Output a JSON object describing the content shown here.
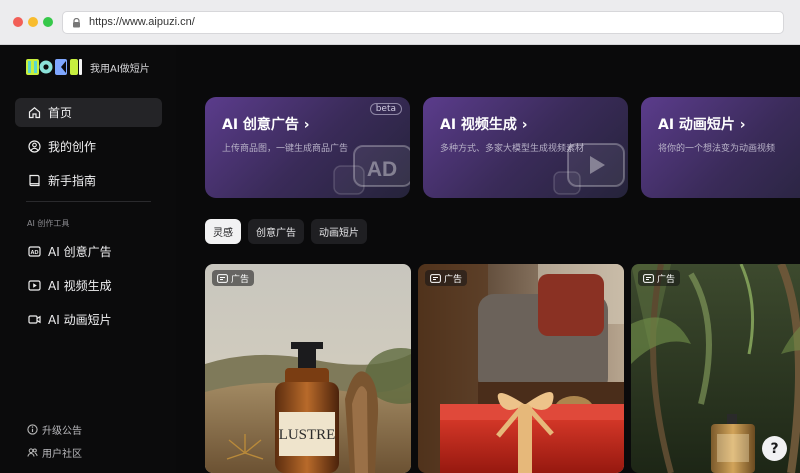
{
  "browser": {
    "url": "https://www.aipuzi.cn/"
  },
  "sidebar": {
    "logo_tagline": "我用AI做短片",
    "items": [
      {
        "label": "首页",
        "icon": "home-icon"
      },
      {
        "label": "我的创作",
        "icon": "user-circle-icon"
      },
      {
        "label": "新手指南",
        "icon": "book-icon"
      }
    ],
    "section_title": "AI 创作工具",
    "tools": [
      {
        "label": "AI 创意广告",
        "icon": "ad-icon"
      },
      {
        "label": "AI 视频生成",
        "icon": "play-icon"
      },
      {
        "label": "AI 动画短片",
        "icon": "video-camera-icon"
      }
    ],
    "bottom": [
      {
        "label": "升级公告",
        "icon": "info-icon"
      },
      {
        "label": "用户社区",
        "icon": "users-icon"
      }
    ]
  },
  "cards": [
    {
      "title": "AI 创意广告 ›",
      "desc": "上传商品图，一键生成商品广告",
      "badge": "beta"
    },
    {
      "title": "AI 视频生成 ›",
      "desc": "多种方式、多家大模型生成视频素材"
    },
    {
      "title": "AI 动画短片 ›",
      "desc": "将你的一个想法变为动画视频"
    }
  ],
  "tabs": [
    {
      "label": "灵感",
      "active": true
    },
    {
      "label": "创意广告",
      "active": false
    },
    {
      "label": "动画短片",
      "active": false
    }
  ],
  "gallery": [
    {
      "label": "广告",
      "product_text": "LUSTRE"
    },
    {
      "label": "广告"
    },
    {
      "label": "广告"
    }
  ],
  "help_label": "?"
}
